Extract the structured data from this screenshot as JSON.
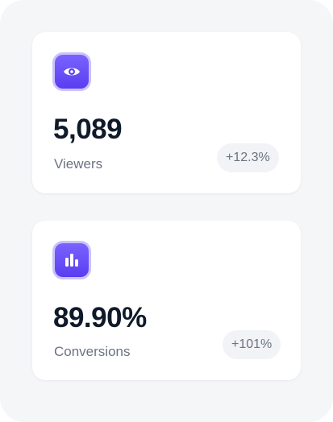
{
  "theme": {
    "accent": "#6a4ff7",
    "panel_background": "#f5f6f8",
    "card_background": "#ffffff",
    "value_color": "#0f1a2a",
    "muted_text": "#6b7382"
  },
  "stats": [
    {
      "icon": "eye-icon",
      "value": "5,089",
      "label": "Viewers",
      "change": "+12.3%"
    },
    {
      "icon": "bar-chart-icon",
      "value": "89.90%",
      "label": "Conversions",
      "change": "+101%"
    }
  ]
}
